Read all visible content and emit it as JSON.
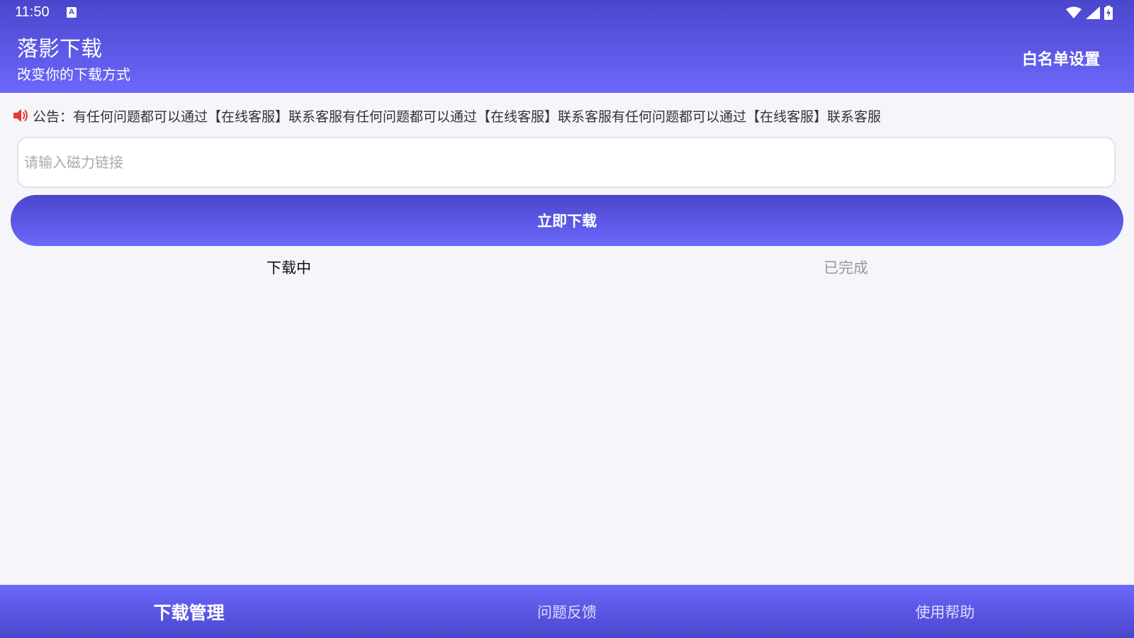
{
  "status_bar": {
    "time": "11:50",
    "input_indicator": "A",
    "icons": [
      "wifi-icon",
      "signal-icon",
      "battery-charging-icon"
    ]
  },
  "header": {
    "title": "落影下载",
    "subtitle": "改变你的下载方式",
    "whitelist_label": "白名单设置"
  },
  "notice": {
    "icon": "speaker-icon",
    "label": "公告：",
    "text": "有任何问题都可以通过【在线客服】联系客服有任何问题都可以通过【在线客服】联系客服有任何问题都可以通过【在线客服】联系客服"
  },
  "magnet_input": {
    "value": "",
    "placeholder": "请输入磁力链接"
  },
  "download_button": {
    "label": "立即下载"
  },
  "tabs": [
    {
      "label": "下载中",
      "active": true
    },
    {
      "label": "已完成",
      "active": false
    }
  ],
  "bottom_nav": [
    {
      "label": "下载管理",
      "active": true
    },
    {
      "label": "问题反馈",
      "active": false
    },
    {
      "label": "使用帮助",
      "active": false
    }
  ],
  "colors": {
    "brand_dark": "#4a46cc",
    "brand_light": "#6c68fb",
    "background": "#f5f5fa",
    "notice_icon": "#e53935"
  }
}
